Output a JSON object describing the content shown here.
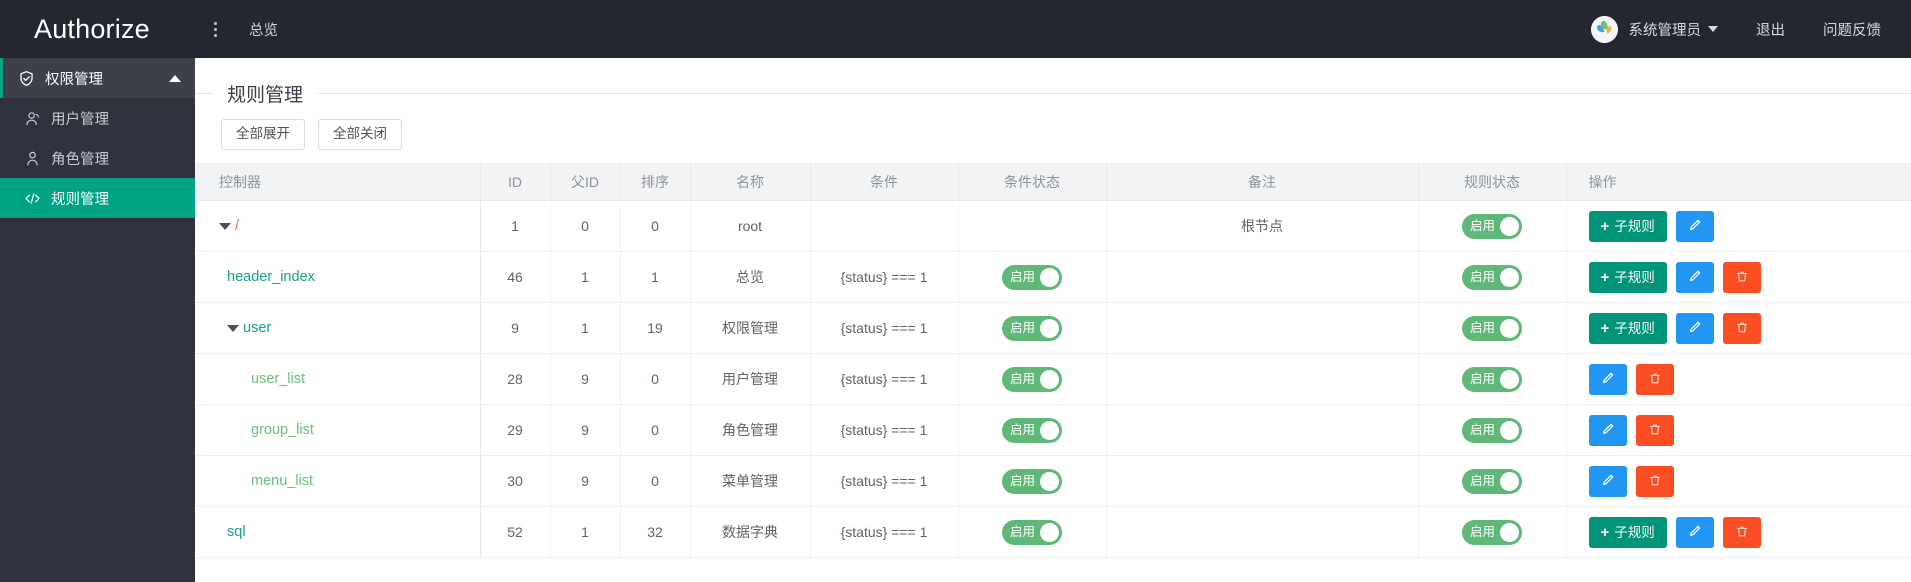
{
  "header": {
    "brand": "Authorize",
    "menu_icon": "kebab-menu-icon",
    "nav": [
      {
        "label": "总览"
      }
    ],
    "avatar_icon": "user-avatar",
    "user_name": "系统管理员",
    "logout": "退出",
    "feedback": "问题反馈"
  },
  "sidebar": {
    "group": {
      "label": "权限管理",
      "icon": "shield-check-icon",
      "expanded": true
    },
    "items": [
      {
        "label": "用户管理",
        "icon": "users-icon",
        "active": false
      },
      {
        "label": "角色管理",
        "icon": "user-icon",
        "active": false
      },
      {
        "label": "规则管理",
        "icon": "code-icon",
        "active": true
      }
    ]
  },
  "panel": {
    "title": "规则管理",
    "buttons": {
      "expand_all": "全部展开",
      "collapse_all": "全部关闭"
    }
  },
  "table": {
    "columns": [
      "控制器",
      "ID",
      "父ID",
      "排序",
      "名称",
      "条件",
      "条件状态",
      "备注",
      "规则状态",
      "操作"
    ],
    "toggle_on_label": "启用",
    "actions": {
      "add_child": "子规则",
      "add_icon": "plus-icon",
      "edit_icon": "pencil-icon",
      "delete_icon": "trash-icon"
    },
    "rows": [
      {
        "controller": "/",
        "level": 0,
        "expandable": true,
        "color": "root",
        "id": "1",
        "parent_id": "0",
        "sort": "0",
        "name": "root",
        "condition": "",
        "condition_status": "",
        "remark": "根节点",
        "rule_status": "启用",
        "has_add": true,
        "has_edit": true,
        "has_delete": false
      },
      {
        "controller": "header_index",
        "level": 1,
        "expandable": false,
        "color": "l1",
        "id": "46",
        "parent_id": "1",
        "sort": "1",
        "name": "总览",
        "condition": "{status} === 1",
        "condition_status": "启用",
        "remark": "",
        "rule_status": "启用",
        "has_add": true,
        "has_edit": true,
        "has_delete": true
      },
      {
        "controller": "user",
        "level": 1,
        "expandable": true,
        "color": "l1",
        "id": "9",
        "parent_id": "1",
        "sort": "19",
        "name": "权限管理",
        "condition": "{status} === 1",
        "condition_status": "启用",
        "remark": "",
        "rule_status": "启用",
        "has_add": true,
        "has_edit": true,
        "has_delete": true
      },
      {
        "controller": "user_list",
        "level": 2,
        "expandable": false,
        "color": "l2",
        "id": "28",
        "parent_id": "9",
        "sort": "0",
        "name": "用户管理",
        "condition": "{status} === 1",
        "condition_status": "启用",
        "remark": "",
        "rule_status": "启用",
        "has_add": false,
        "has_edit": true,
        "has_delete": true
      },
      {
        "controller": "group_list",
        "level": 2,
        "expandable": false,
        "color": "l2",
        "id": "29",
        "parent_id": "9",
        "sort": "0",
        "name": "角色管理",
        "condition": "{status} === 1",
        "condition_status": "启用",
        "remark": "",
        "rule_status": "启用",
        "has_add": false,
        "has_edit": true,
        "has_delete": true
      },
      {
        "controller": "menu_list",
        "level": 2,
        "expandable": false,
        "color": "l2",
        "id": "30",
        "parent_id": "9",
        "sort": "0",
        "name": "菜单管理",
        "condition": "{status} === 1",
        "condition_status": "启用",
        "remark": "",
        "rule_status": "启用",
        "has_add": false,
        "has_edit": true,
        "has_delete": true
      },
      {
        "controller": "sql",
        "level": 1,
        "expandable": false,
        "color": "l1",
        "id": "52",
        "parent_id": "1",
        "sort": "32",
        "name": "数据字典",
        "condition": "{status} === 1",
        "condition_status": "启用",
        "remark": "",
        "rule_status": "启用",
        "has_add": true,
        "has_edit": true,
        "has_delete": true
      }
    ]
  },
  "colors": {
    "topbar_bg": "#242730",
    "sidebar_bg": "#30333d",
    "sidebar_group_bg": "#3c4049",
    "accent_teal": "#00a383",
    "toggle_green": "#5fb878",
    "btn_add_green": "#009479",
    "btn_edit_blue": "#2196f3",
    "btn_delete_orange": "#fa4d21",
    "link_l1": "#1ba188",
    "link_l2": "#6cbf7a",
    "link_root": "#ff6a3d"
  }
}
